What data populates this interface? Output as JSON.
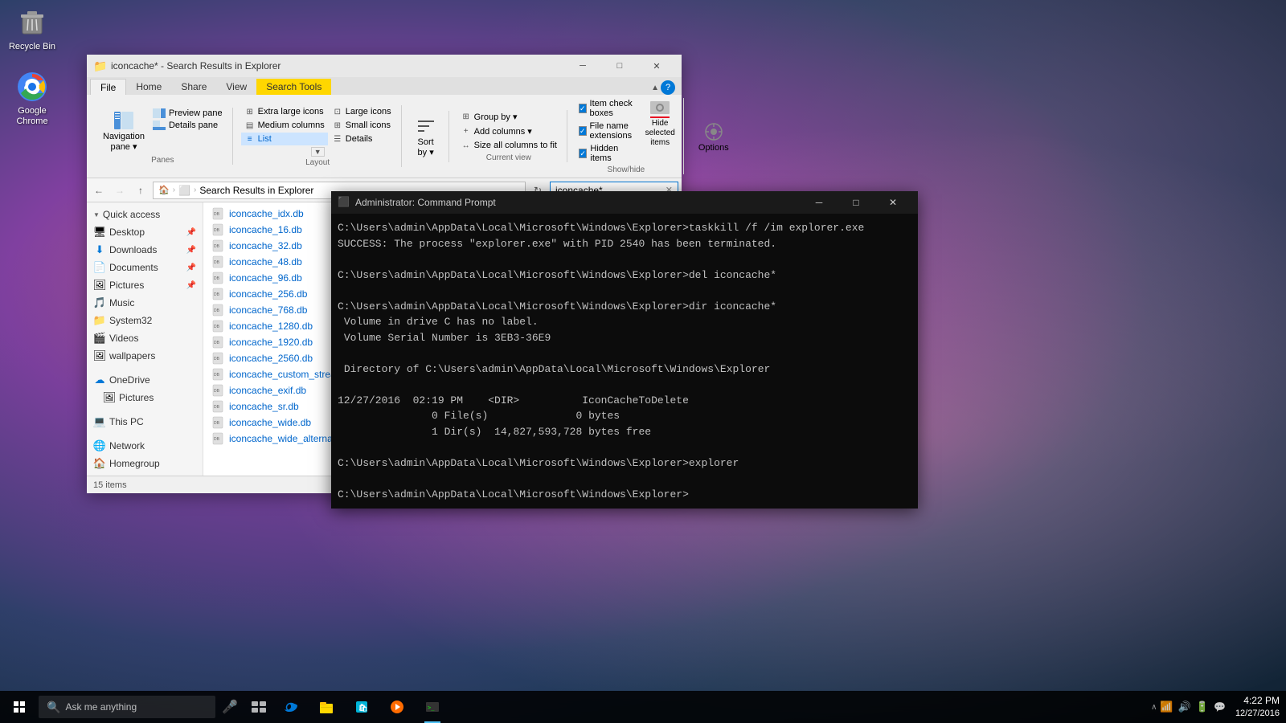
{
  "desktop": {
    "icons": [
      {
        "id": "recycle-bin",
        "label": "Recycle Bin",
        "unicode": "🗑"
      },
      {
        "id": "google-chrome",
        "label": "Google Chrome",
        "unicode": "⬤"
      }
    ]
  },
  "explorer": {
    "title": "iconcache* - Search Results in Explorer",
    "tabs": [
      "File",
      "Home",
      "Share",
      "View",
      "Search Tools"
    ],
    "active_tab": "Search Tools",
    "ribbon": {
      "panes": {
        "label": "Panes",
        "navigation_pane": "Navigation pane",
        "preview_pane": "Preview pane",
        "details_pane": "Details pane"
      },
      "layout": {
        "label": "Layout",
        "options": [
          "Extra large icons",
          "Large icons",
          "Medium columns",
          "Small icons",
          "List",
          "Details"
        ],
        "active": "List"
      },
      "current_view": {
        "label": "Current view",
        "options": [
          "Group by ▾",
          "Add columns ▾",
          "Size all columns to fit"
        ]
      },
      "show_hide": {
        "label": "Show/hide",
        "checkboxes": [
          {
            "label": "Item check boxes",
            "checked": true
          },
          {
            "label": "File name extensions",
            "checked": true
          },
          {
            "label": "Hidden items",
            "checked": true
          }
        ],
        "hide_selected_label": "Hide selected\nitems"
      },
      "options": {
        "label": "Options"
      }
    },
    "address": {
      "back": "←",
      "forward": "→",
      "up": "↑",
      "path_parts": [
        "Search Results in Explorer"
      ],
      "search_value": "iconcache*"
    },
    "sidebar": {
      "quick_access": {
        "label": "Quick access",
        "items": [
          {
            "icon": "🖥",
            "label": "Desktop",
            "pinned": true
          },
          {
            "icon": "⬇",
            "label": "Downloads",
            "pinned": true
          },
          {
            "icon": "📄",
            "label": "Documents",
            "pinned": true
          },
          {
            "icon": "🖼",
            "label": "Pictures",
            "pinned": true
          },
          {
            "icon": "🎵",
            "label": "Music"
          },
          {
            "icon": "📁",
            "label": "System32"
          },
          {
            "icon": "🎬",
            "label": "Videos"
          },
          {
            "icon": "🖼",
            "label": "wallpapers"
          }
        ]
      },
      "onedrive": {
        "icon": "☁",
        "label": "OneDrive"
      },
      "onedrive_pictures": {
        "icon": "🖼",
        "label": "Pictures"
      },
      "this_pc": {
        "icon": "💻",
        "label": "This PC"
      },
      "network": {
        "icon": "🌐",
        "label": "Network"
      },
      "homegroup": {
        "icon": "🏠",
        "label": "Homegroup"
      }
    },
    "files": [
      "iconcache_idx.db",
      "iconcache_16.db",
      "iconcache_32.db",
      "iconcache_48.db",
      "iconcache_96.db",
      "iconcache_256.db",
      "iconcache_768.db",
      "iconcache_1280.db",
      "iconcache_1920.db",
      "iconcache_2560.db",
      "iconcache_custom_stream.db",
      "iconcache_exif.db",
      "iconcache_sr.db",
      "iconcache_wide.db",
      "iconcache_wide_alternate.db"
    ],
    "status": "15 items"
  },
  "cmd": {
    "title": "Administrator: Command Prompt",
    "content": "C:\\Users\\admin\\AppData\\Local\\Microsoft\\Windows\\Explorer>taskkill /f /im explorer.exe\nSUCCESS: The process \"explorer.exe\" with PID 2540 has been terminated.\n\nC:\\Users\\admin\\AppData\\Local\\Microsoft\\Windows\\Explorer>del iconcache*\n\nC:\\Users\\admin\\AppData\\Local\\Microsoft\\Windows\\Explorer>dir iconcache*\n Volume in drive C has no label.\n Volume Serial Number is 3EB3-36E9\n\n Directory of C:\\Users\\admin\\AppData\\Local\\Microsoft\\Windows\\Explorer\n\n12/27/2016  02:19 PM    <DIR>          IconCacheToDelete\n               0 File(s)              0 bytes\n               1 Dir(s)  14,827,593,728 bytes free\n\nC:\\Users\\admin\\AppData\\Local\\Microsoft\\Windows\\Explorer>explorer\n\nC:\\Users\\admin\\AppData\\Local\\Microsoft\\Windows\\Explorer>"
  },
  "taskbar": {
    "search_placeholder": "Ask me anything",
    "apps": [
      {
        "id": "edge",
        "label": "Microsoft Edge"
      },
      {
        "id": "explorer",
        "label": "File Explorer"
      },
      {
        "id": "store",
        "label": "Windows Store"
      },
      {
        "id": "media",
        "label": "Media"
      },
      {
        "id": "cmd",
        "label": "Command Prompt"
      }
    ],
    "tray": {
      "time": "4:22 PM",
      "date": "12/27/2016"
    }
  }
}
